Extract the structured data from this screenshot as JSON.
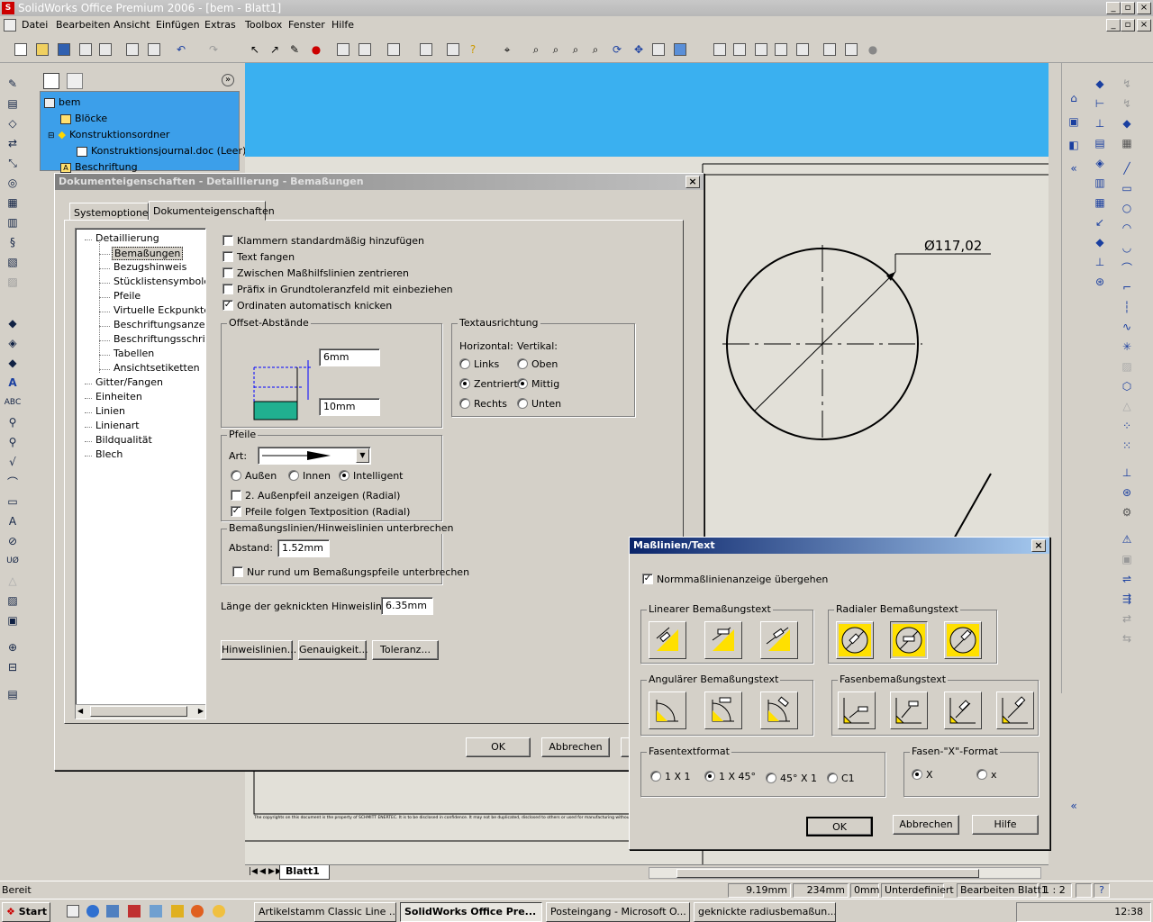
{
  "app": {
    "title": "SolidWorks Office Premium 2006 - [bem - Blatt1]"
  },
  "menu": [
    "Datei",
    "Bearbeiten",
    "Ansicht",
    "Einfügen",
    "Extras",
    "Toolbox",
    "Fenster",
    "Hilfe"
  ],
  "tree": {
    "root": "bem",
    "items": [
      "Blöcke",
      "Konstruktionsordner",
      "Konstruktionsjournal.doc (Leer)",
      "Beschriftung"
    ]
  },
  "drawing": {
    "dimension_label": "Ø117,02",
    "footer_text": "The copyrights on this document is the property of SCHMITT ENERTEC. It is to be disclosed in confidence. It may not be duplicated, disclosed to others or used for manufacturing without the prior written consent.",
    "sheet_tab": "Blatt1"
  },
  "doc_dialog": {
    "title": "Dokumenteigenschaften - Detaillierung - Bemaßungen",
    "tabs": [
      "Systemoptionen",
      "Dokumenteigenschaften"
    ],
    "nav": [
      {
        "label": "Detaillierung",
        "level": 0
      },
      {
        "label": "Bemaßungen",
        "level": 1,
        "selected": true
      },
      {
        "label": "Bezugshinweis",
        "level": 1
      },
      {
        "label": "Stücklistensymbole",
        "level": 1
      },
      {
        "label": "Pfeile",
        "level": 1
      },
      {
        "label": "Virtuelle Eckpunkte",
        "level": 1
      },
      {
        "label": "Beschriftungsanzeige",
        "level": 1
      },
      {
        "label": "Beschriftungsschriftart",
        "level": 1
      },
      {
        "label": "Tabellen",
        "level": 1
      },
      {
        "label": "Ansichtsetiketten",
        "level": 1
      },
      {
        "label": "Gitter/Fangen",
        "level": 0
      },
      {
        "label": "Einheiten",
        "level": 0
      },
      {
        "label": "Linien",
        "level": 0
      },
      {
        "label": "Linienart",
        "level": 0
      },
      {
        "label": "Bildqualität",
        "level": 0
      },
      {
        "label": "Blech",
        "level": 0
      }
    ],
    "checks": [
      {
        "label": "Klammern standardmäßig hinzufügen",
        "checked": false
      },
      {
        "label": "Text fangen",
        "checked": false
      },
      {
        "label": "Zwischen Maßhilfslinien zentrieren",
        "checked": false
      },
      {
        "label": "Präfix in Grundtoleranzfeld mit einbeziehen",
        "checked": false
      },
      {
        "label": "Ordinaten automatisch knicken",
        "checked": true
      }
    ],
    "offset": {
      "title": "Offset-Abstände",
      "top": "6mm",
      "bottom": "10mm"
    },
    "textalign": {
      "title": "Textausrichtung",
      "horizontal": "Horizontal:",
      "vertical": "Vertikal:",
      "h_opts": [
        "Links",
        "Zentriert",
        "Rechts"
      ],
      "h_sel": 1,
      "v_opts": [
        "Oben",
        "Mittig",
        "Unten"
      ],
      "v_sel": 1
    },
    "arrows": {
      "title": "Pfeile",
      "art_label": "Art:",
      "opts": [
        "Außen",
        "Innen",
        "Intelligent"
      ],
      "sel": 2,
      "check1": "2. Außenpfeil anzeigen (Radial)",
      "check1_on": false,
      "check2": "Pfeile folgen Textposition (Radial)",
      "check2_on": true
    },
    "break": {
      "title": "Bemaßungslinien/Hinweislinien unterbrechen",
      "abstand_label": "Abstand:",
      "abstand": "1.52mm",
      "check": "Nur rund um Bemaßungspfeile unterbrechen"
    },
    "leader": {
      "label": "Länge der geknickten Hinweislinie:",
      "value": "6.35mm"
    },
    "buttons": [
      "Hinweislinien...",
      "Genauigkeit...",
      "Toleranz..."
    ],
    "ok": "OK",
    "cancel": "Abbrechen"
  },
  "mass_dialog": {
    "title": "Maßlinien/Text",
    "override": "Normmaßlinienanzeige übergehen",
    "linear": "Linearer Bemaßungstext",
    "radial": "Radialer Bemaßungstext",
    "angular": "Angulärer Bemaßungstext",
    "chamfer": "Fasenbemaßungstext",
    "chamfer_format": {
      "title": "Fasentextformat",
      "opts": [
        "1 X 1",
        "1 X 45°",
        "45° X 1",
        "C1"
      ],
      "sel": 1
    },
    "x_format": {
      "title": "Fasen-\"X\"-Format",
      "opts": [
        "X",
        "x"
      ],
      "sel": 0
    },
    "ok": "OK",
    "cancel": "Abbrechen",
    "help": "Hilfe"
  },
  "status": {
    "ready": "Bereit",
    "x": "9.19mm",
    "y": "234mm",
    "z": "0mm",
    "state": "Unterdefiniert",
    "mode": "Bearbeiten Blatt1",
    "scale": "1 : 2"
  },
  "taskbar": {
    "start": "Start",
    "tasks": [
      "Artikelstamm  Classic Line ...",
      "SolidWorks Office Pre...",
      "Posteingang - Microsoft O...",
      "geknickte radiusbemaßun..."
    ],
    "active": 1,
    "clock": "12:38"
  }
}
